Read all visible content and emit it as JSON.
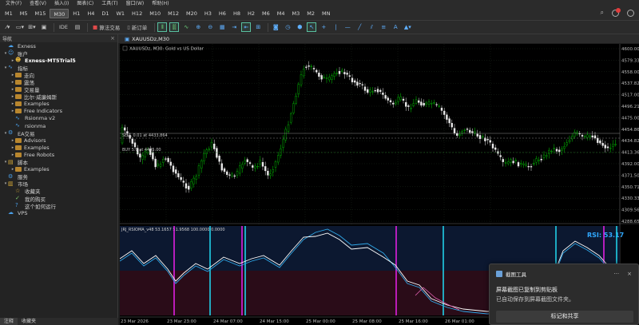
{
  "menu": [
    "文件(F)",
    "查看(V)",
    "插入(I)",
    "图表(C)",
    "工具(T)",
    "窗口(W)",
    "帮助(H)"
  ],
  "timeframes": [
    "M1",
    "M5",
    "M15",
    "M30",
    "H1",
    "H4",
    "D1",
    "W1",
    "H12",
    "M10",
    "M12",
    "M20",
    "H3",
    "H6",
    "H8",
    "H2",
    "M6",
    "M4",
    "M3",
    "M2",
    "MN"
  ],
  "active_timeframe": "M30",
  "toolbar": {
    "ide_label": "IDE",
    "algo_label": "算法交易",
    "new_order_label": "新订单"
  },
  "navigator": {
    "title": "导航",
    "tree": [
      {
        "level": 0,
        "icon": "exness-icon",
        "label": "Exness",
        "arrow": ""
      },
      {
        "level": 0,
        "icon": "account-icon",
        "label": "账户",
        "arrow": "▾"
      },
      {
        "level": 1,
        "icon": "user-icon",
        "label": "Exness-MT5Trial5",
        "arrow": "▸",
        "bold": true
      },
      {
        "level": 0,
        "icon": "indicators-icon",
        "label": "指标",
        "arrow": "▾"
      },
      {
        "level": 1,
        "icon": "folder-icon",
        "label": "走向",
        "arrow": "▸"
      },
      {
        "level": 1,
        "icon": "folder-icon",
        "label": "震荡",
        "arrow": "▸"
      },
      {
        "level": 1,
        "icon": "folder-icon",
        "label": "交易量",
        "arrow": "▸"
      },
      {
        "level": 1,
        "icon": "folder-icon",
        "label": "比尔·威廉姆斯",
        "arrow": "▸"
      },
      {
        "level": 1,
        "icon": "folder-icon",
        "label": "Examples",
        "arrow": "▸"
      },
      {
        "level": 1,
        "icon": "folder-icon",
        "label": "Free Indicators",
        "arrow": "▸"
      },
      {
        "level": 1,
        "icon": "indicator-file-icon",
        "label": "Rsionma v2",
        "arrow": ""
      },
      {
        "level": 1,
        "icon": "indicator-file-icon",
        "label": "rsionma",
        "arrow": ""
      },
      {
        "level": 0,
        "icon": "ea-icon",
        "label": "EA交易",
        "arrow": "▾"
      },
      {
        "level": 1,
        "icon": "folder-icon",
        "label": "Advisors",
        "arrow": "▸"
      },
      {
        "level": 1,
        "icon": "folder-icon",
        "label": "Examples",
        "arrow": "▸"
      },
      {
        "level": 1,
        "icon": "folder-icon",
        "label": "Free Robots",
        "arrow": "▸"
      },
      {
        "level": 0,
        "icon": "script-icon",
        "label": "脚本",
        "arrow": "▾"
      },
      {
        "level": 1,
        "icon": "folder-icon",
        "label": "Examples",
        "arrow": "▸"
      },
      {
        "level": 0,
        "icon": "services-icon",
        "label": "服务",
        "arrow": ""
      },
      {
        "level": 0,
        "icon": "market-icon",
        "label": "市场",
        "arrow": "▾"
      },
      {
        "level": 1,
        "icon": "star-icon",
        "label": "收藏夹",
        "arrow": ""
      },
      {
        "level": 1,
        "icon": "check-icon",
        "label": "我的购买",
        "arrow": ""
      },
      {
        "level": 1,
        "icon": "question-icon",
        "label": "这个如何运行",
        "arrow": ""
      },
      {
        "level": 0,
        "icon": "cloud-icon",
        "label": "VPS",
        "arrow": ""
      }
    ]
  },
  "bottom_tabs": [
    "注释",
    "收藏夹"
  ],
  "chart_tab": "XAUUSDz,M30",
  "chart": {
    "header": "XAUUSDz, M30:  Gold vs US Dollar",
    "price_labels": [
      "4600.00",
      "4579.33",
      "4558.00",
      "4537.82",
      "4517.00",
      "4496.21",
      "4475.00",
      "4454.86",
      "4434.82",
      "4413.36",
      "4392.00",
      "4371.50",
      "4350.71",
      "4330.33",
      "4309.56",
      "4288.65"
    ],
    "sell_line_label": "SELL 0.01 at 4433.864",
    "buy_line_label": "BUY 5.0 at 4405.00",
    "sub_header": "JRJ_RSIOMA_v48 53.1657 51.9568 100.0000 0.0000",
    "rsi_label": "RSI: 53.17",
    "time_labels": [
      "23 Mar 2026",
      "23 Mar 23:00",
      "24 Mar 07:00",
      "24 Mar 15:00",
      "25 Mar 00:00",
      "25 Mar 08:00",
      "25 Mar 16:00",
      "26 Mar 01:00",
      "26 Mar 09:00"
    ]
  },
  "toast": {
    "app": "截图工具",
    "line1": "屏幕截图已复制到剪贴板",
    "line2": "已自动保存到屏幕截图文件夹。",
    "button": "标记和共享"
  },
  "colors": {
    "bull": "#00c800",
    "bear": "#e8e8e8",
    "magenta": "#e020e0",
    "cyan": "#20d0e8",
    "rsi_fast": "#30a8e8",
    "rsi_slow": "#ffffff"
  }
}
